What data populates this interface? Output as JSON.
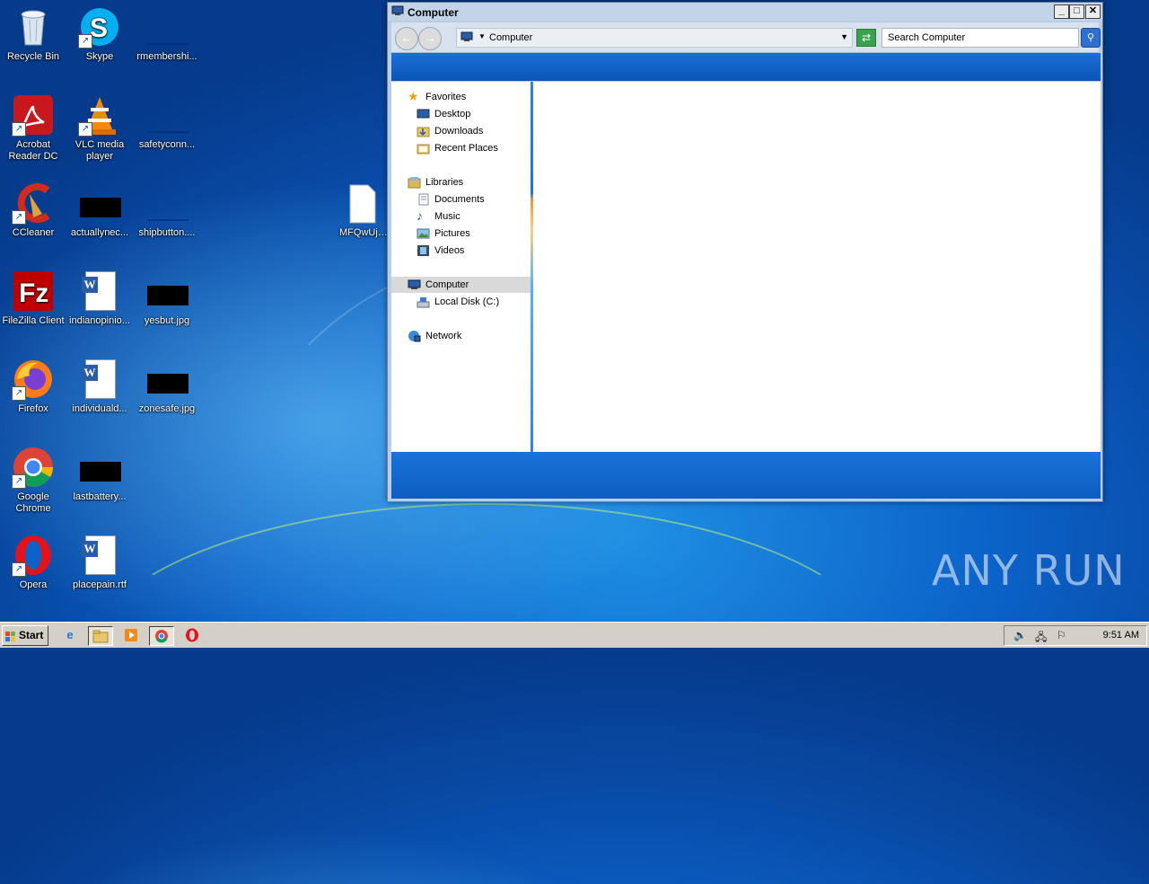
{
  "desktop": {
    "icons": [
      {
        "label": "Recycle Bin"
      },
      {
        "label": "Skype"
      },
      {
        "label": "rmembershi..."
      },
      {
        "label": "Acrobat Reader DC"
      },
      {
        "label": "VLC media player"
      },
      {
        "label": "safetyconn..."
      },
      {
        "label": "CCleaner"
      },
      {
        "label": "actuallynec..."
      },
      {
        "label": "shipbutton...."
      },
      {
        "label": "FileZilla Client"
      },
      {
        "label": "indianopinio..."
      },
      {
        "label": "yesbut.jpg"
      },
      {
        "label": "Firefox"
      },
      {
        "label": "individuald..."
      },
      {
        "label": "zonesafe.jpg"
      },
      {
        "label": "Google Chrome"
      },
      {
        "label": "lastbattery..."
      },
      {
        "label": "Opera"
      },
      {
        "label": "placepain.rtf"
      },
      {
        "label": "MFQwUjBC..."
      }
    ]
  },
  "window": {
    "title": "Computer",
    "address": "Computer",
    "search_placeholder": "Search Computer",
    "nav": {
      "favorites": "Favorites",
      "desktop": "Desktop",
      "downloads": "Downloads",
      "recent": "Recent Places",
      "libraries": "Libraries",
      "documents": "Documents",
      "music": "Music",
      "pictures": "Pictures",
      "videos": "Videos",
      "computer": "Computer",
      "local_disk": "Local Disk (C:)",
      "network": "Network"
    }
  },
  "taskbar": {
    "start_label": "Start",
    "clock": "9:51 AM"
  },
  "watermark": "ANY RUN",
  "colors": {
    "desktop_blue": "#0b63c9",
    "window_frame": "#b9cde5",
    "nav_selected": "#d9d9d9",
    "taskbar": "#d4d0c8"
  }
}
